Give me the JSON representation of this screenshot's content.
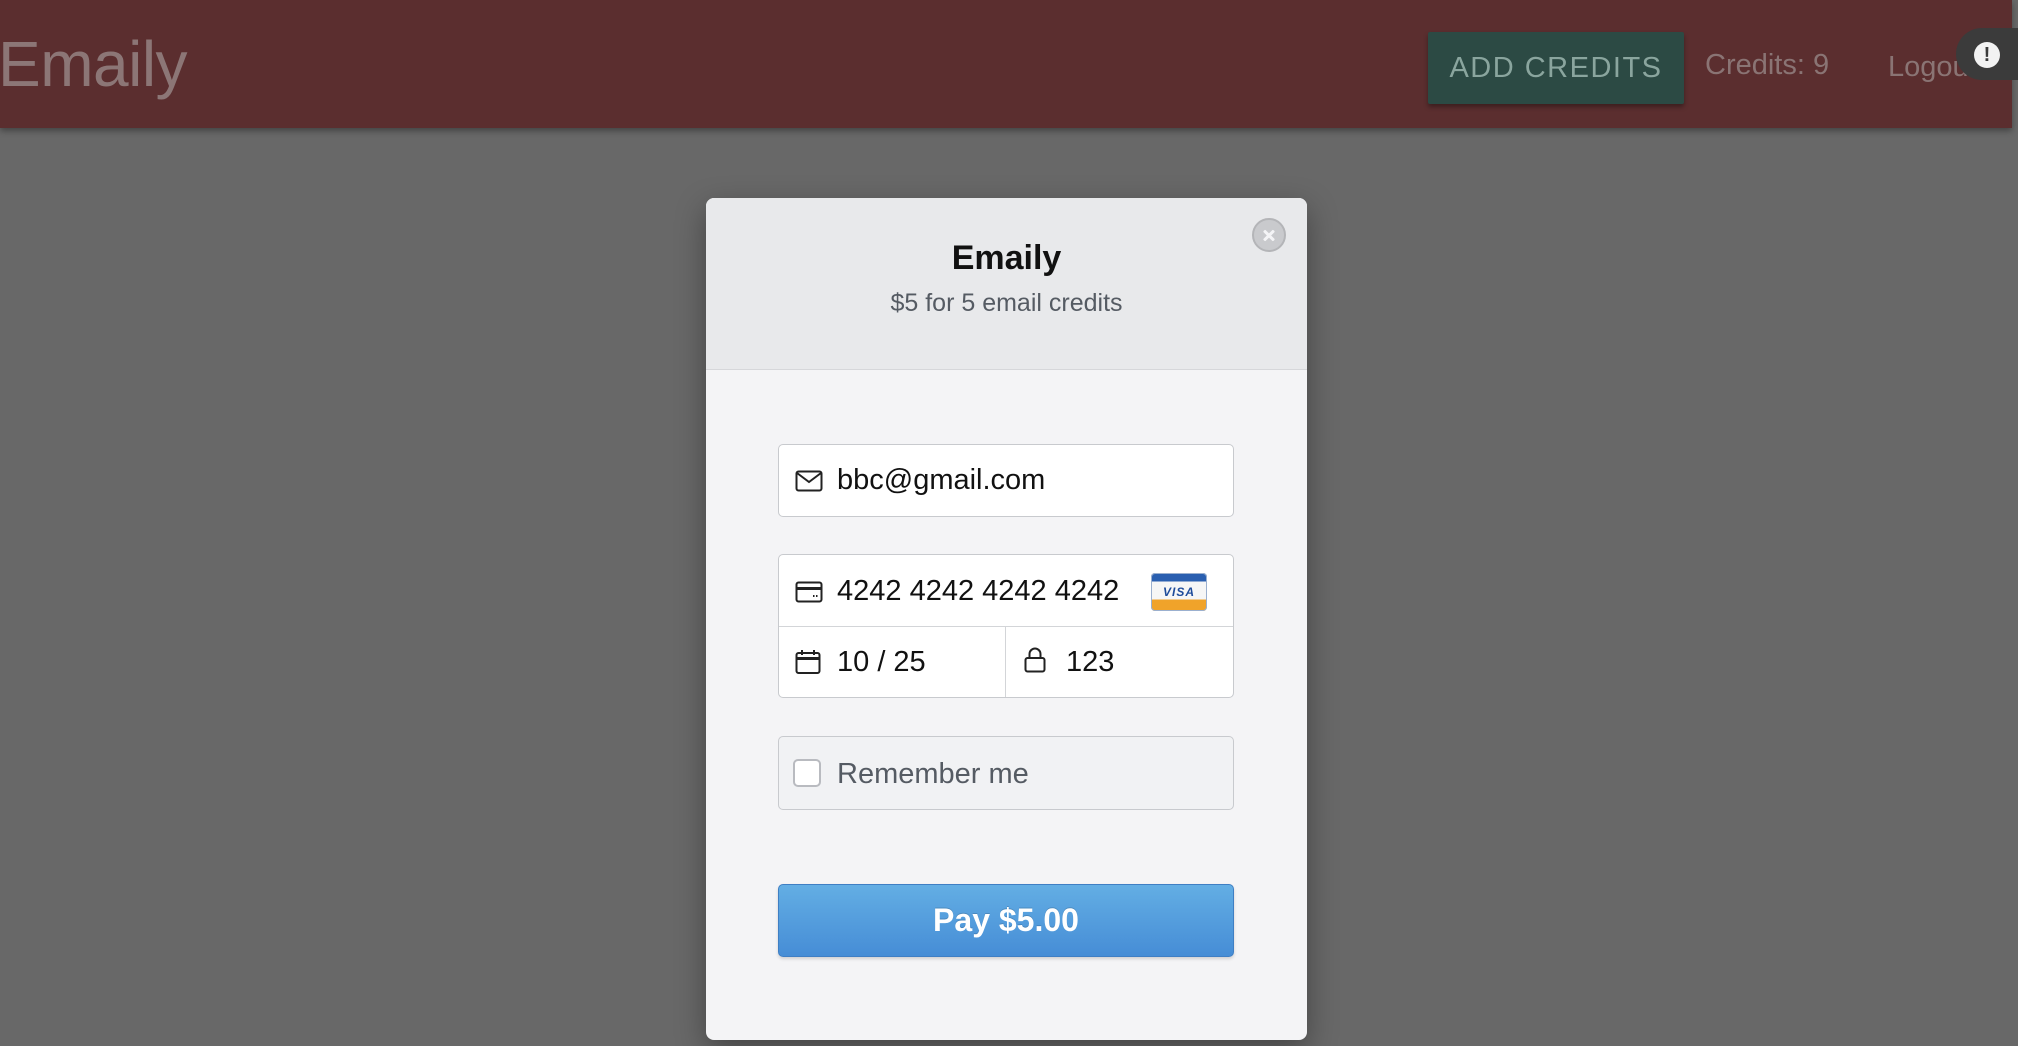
{
  "navbar": {
    "brand": "Emaily",
    "add_credits_label": "ADD CREDITS",
    "credits_label": "Credits: 9",
    "logout_label": "Logout",
    "extension_icon": "alert-icon",
    "extension_glyph": "!"
  },
  "modal": {
    "title": "Emaily",
    "description": "$5 for 5 email credits",
    "close_icon": "close-icon",
    "email": {
      "icon": "envelope-icon",
      "value": "bbc@gmail.com"
    },
    "card": {
      "icon": "credit-card-icon",
      "number": "4242 4242 4242 4242",
      "brand": "VISA",
      "expiry_icon": "calendar-icon",
      "expiry": "10 / 25",
      "cvc_icon": "lock-icon",
      "cvc": "123"
    },
    "remember_me": {
      "label": "Remember me",
      "checked": false
    },
    "pay_button_label": "Pay $5.00"
  },
  "colors": {
    "navbar": "#5b2e2f",
    "accent_button": "#2c4a44",
    "pay_button": "#4a92d9",
    "overlay": "#686868"
  }
}
